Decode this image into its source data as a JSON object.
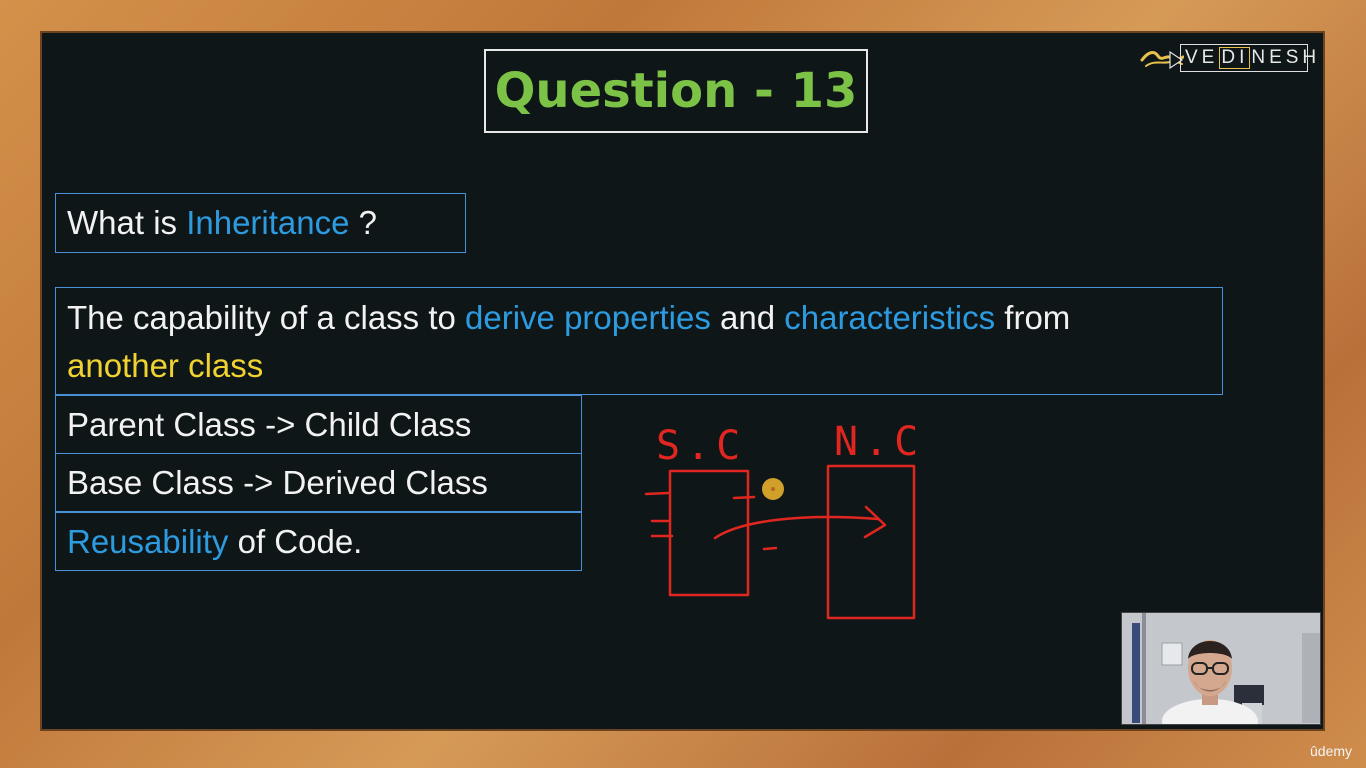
{
  "slide": {
    "title": "Question - 13",
    "brand": {
      "prefix": "VE",
      "highlight": "DI",
      "suffix": "NESH"
    },
    "question": {
      "lead": "What is ",
      "term": "Inheritance",
      "tail": " ?"
    },
    "definition": {
      "part1": "The capability of a class to ",
      "part2": "derive properties",
      "part3": " and ",
      "part4": "characteristics",
      "part5": " from",
      "part6": "another class"
    },
    "rows": {
      "row1": "Parent Class -> Child Class",
      "row2": "Base Class -> Derived Class",
      "row3_term": "Reusability",
      "row3_tail": " of Code."
    },
    "annotation": {
      "left_label": "S.C",
      "right_label": "N.C"
    }
  },
  "watermark": "ûdemy",
  "colors": {
    "title_green": "#7cc246",
    "accent_blue": "#2d9be0",
    "accent_yellow": "#f0d331",
    "pen_red": "#e0261f",
    "board": "#0f1618",
    "frame_wood": "#c98844"
  }
}
